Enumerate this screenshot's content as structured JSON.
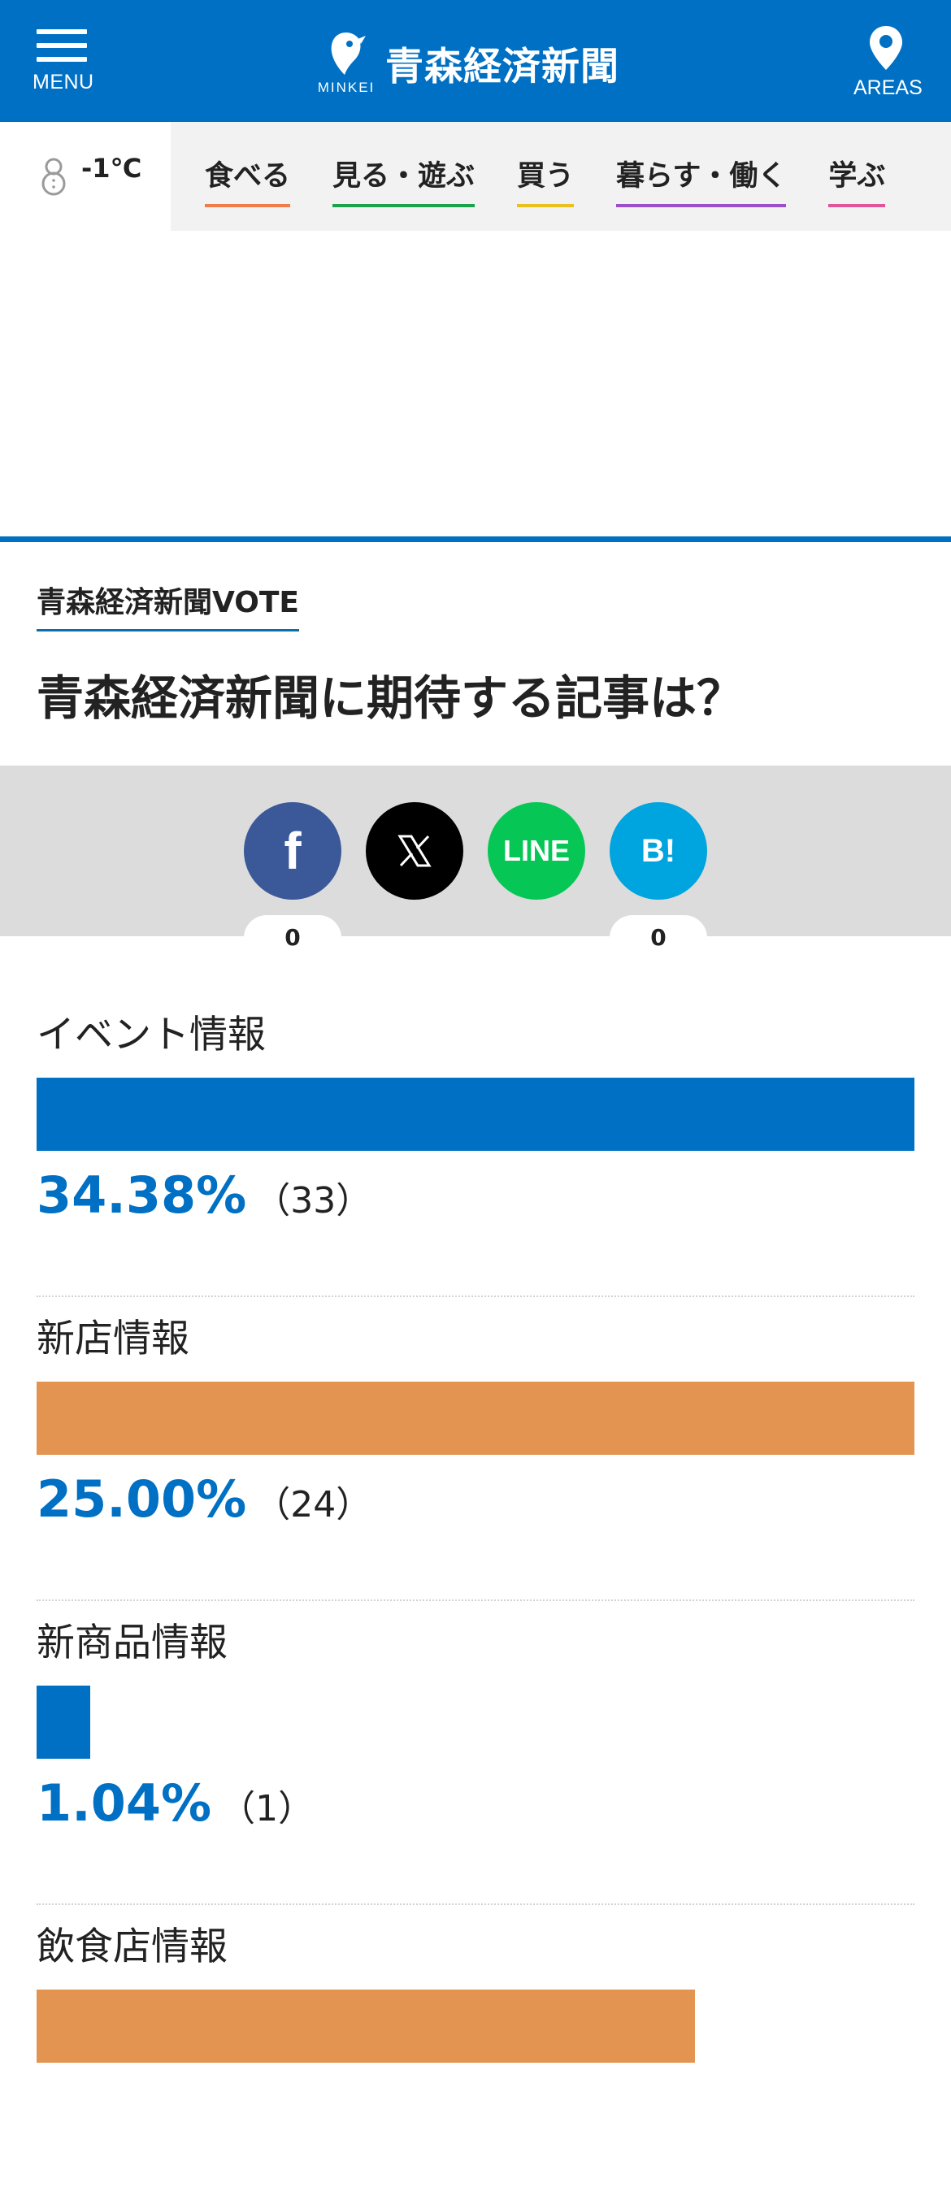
{
  "header": {
    "menu_label": "MENU",
    "logo_sub": "MINKEI",
    "site_name": "青森経済新聞",
    "areas_label": "AREAS",
    "bg_color": "#0070c4"
  },
  "weather": {
    "icon": "snowman-icon",
    "temperature": "-1℃"
  },
  "categories": [
    {
      "label": "食べる",
      "color": "#f07c4a"
    },
    {
      "label": "見る・遊ぶ",
      "color": "#1aa34a"
    },
    {
      "label": "買う",
      "color": "#e8c020"
    },
    {
      "label": "暮らす・働く",
      "color": "#9b4fc8"
    },
    {
      "label": "学ぶ",
      "color": "#e0559a"
    }
  ],
  "vote": {
    "section_label": "青森経済新聞VOTE",
    "question": "青森経済新聞に期待する記事は？"
  },
  "share": {
    "facebook": {
      "icon": "facebook-icon",
      "glyph": "f",
      "count": "0"
    },
    "x": {
      "icon": "x-icon"
    },
    "line": {
      "icon": "line-icon",
      "glyph": "LINE"
    },
    "hatena": {
      "icon": "hatena-bookmark-icon",
      "glyph": "B!",
      "count": "0"
    }
  },
  "results": [
    {
      "label": "イベント情報",
      "percent": "34.38%",
      "count": "（33）",
      "ratio": 1.0,
      "color": "#0070c4"
    },
    {
      "label": "新店情報",
      "percent": "25.00%",
      "count": "（24）",
      "ratio": 1.0,
      "color": "#e39450"
    },
    {
      "label": "新商品情報",
      "percent": "1.04%",
      "count": "（1）",
      "ratio": 0.061,
      "color": "#0070c4"
    },
    {
      "label": "飲食店情報",
      "percent": "",
      "count": "",
      "ratio": 0.75,
      "color": "#e39450"
    }
  ]
}
